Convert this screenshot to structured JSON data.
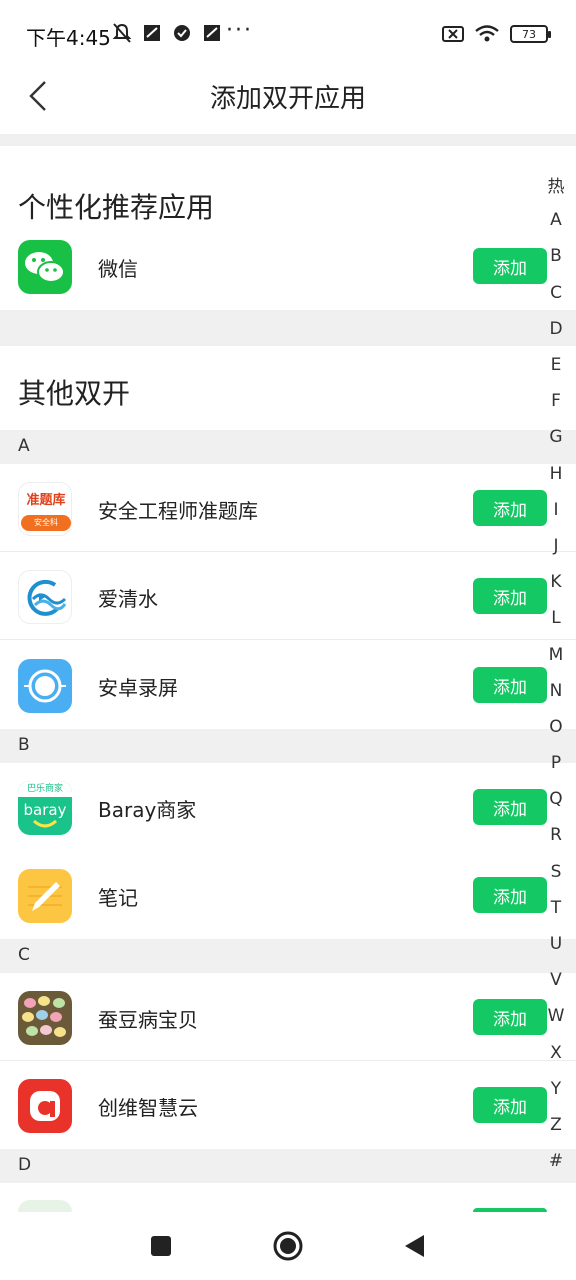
{
  "status_bar": {
    "time": "下午4:45",
    "dots": "···",
    "battery": "73"
  },
  "header": {
    "title": "添加双开应用"
  },
  "recommended": {
    "title": "个性化推荐应用",
    "apps": [
      {
        "name": "微信",
        "icon": "wechat-icon",
        "add_label": "添加"
      }
    ]
  },
  "others": {
    "title": "其他双开",
    "groups": [
      {
        "letter": "A",
        "apps": [
          {
            "name": "安全工程师准题库",
            "icon": "safety-exam-icon",
            "add_label": "添加"
          },
          {
            "name": "爱清水",
            "icon": "aiqingshui-icon",
            "add_label": "添加"
          },
          {
            "name": "安卓录屏",
            "icon": "screen-recorder-icon",
            "add_label": "添加"
          }
        ]
      },
      {
        "letter": "B",
        "apps": [
          {
            "name": "Baray商家",
            "icon": "baray-icon",
            "add_label": "添加"
          },
          {
            "name": "笔记",
            "icon": "notes-icon",
            "add_label": "添加"
          }
        ]
      },
      {
        "letter": "C",
        "apps": [
          {
            "name": "蚕豆病宝贝",
            "icon": "candou-icon",
            "add_label": "添加"
          },
          {
            "name": "创维智慧云",
            "icon": "skyworth-icon",
            "add_label": "添加"
          }
        ]
      },
      {
        "letter": "D",
        "apps": []
      }
    ]
  },
  "icon_text": {
    "safety_exam_top": "准题库",
    "safety_exam_bottom": "安全科",
    "baray_top": "巴乐商家",
    "baray_word": "baray"
  },
  "index_bar": [
    "热",
    "A",
    "B",
    "C",
    "D",
    "E",
    "F",
    "G",
    "H",
    "I",
    "J",
    "K",
    "L",
    "M",
    "N",
    "O",
    "P",
    "Q",
    "R",
    "S",
    "T",
    "U",
    "V",
    "W",
    "X",
    "Y",
    "Z",
    "#"
  ],
  "colors": {
    "accent": "#14c864",
    "band": "#f0f0f0"
  }
}
